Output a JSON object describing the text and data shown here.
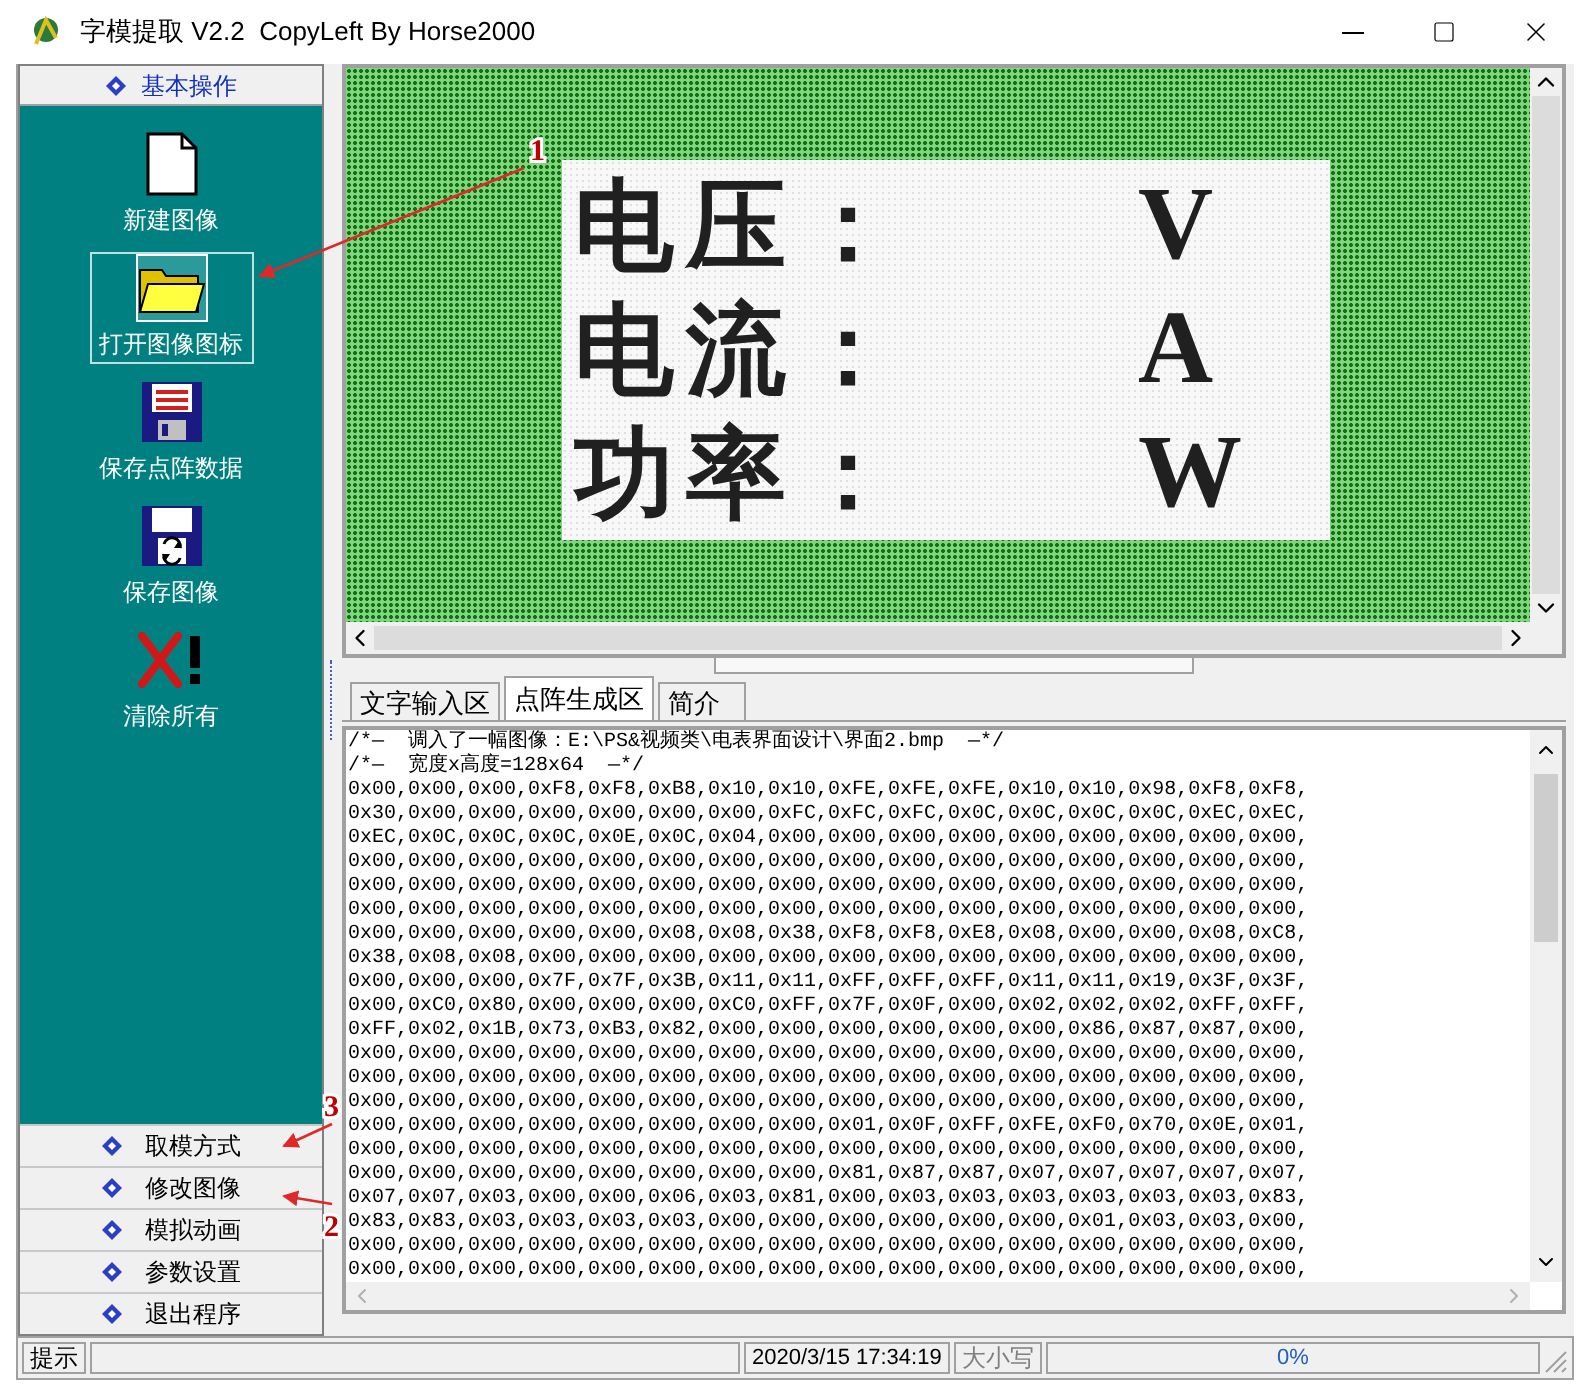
{
  "window": {
    "title": "字模提取 V2.2  CopyLeft By Horse2000"
  },
  "sidebar": {
    "header": "基本操作",
    "tools": [
      {
        "label": "新建图像",
        "kind": "new",
        "selected": false
      },
      {
        "label": "打开图像图标",
        "kind": "open",
        "selected": true
      },
      {
        "label": "保存点阵数据",
        "kind": "save-data",
        "selected": false
      },
      {
        "label": "保存图像",
        "kind": "save-image",
        "selected": false
      },
      {
        "label": "清除所有",
        "kind": "clear",
        "selected": false
      }
    ],
    "sections": [
      "取模方式",
      "修改图像",
      "模拟动画",
      "参数设置",
      "退出程序"
    ]
  },
  "canvas": {
    "rows": [
      {
        "label": "电压：",
        "unit": "V"
      },
      {
        "label": "电流：",
        "unit": "A"
      },
      {
        "label": "功率：",
        "unit": "W"
      }
    ]
  },
  "tabs": [
    {
      "label": "文字输入区",
      "selected": false
    },
    {
      "label": "点阵生成区",
      "selected": true
    },
    {
      "label": "简介",
      "selected": false
    }
  ],
  "output": {
    "lines": [
      "/*—  调入了一幅图像：E:\\PS&视频类\\电表界面设计\\界面2.bmp  —*/",
      "/*—  宽度x高度=128x64  —*/",
      "0x00,0x00,0x00,0xF8,0xF8,0xB8,0x10,0x10,0xFE,0xFE,0xFE,0x10,0x10,0x98,0xF8,0xF8,",
      "0x30,0x00,0x00,0x00,0x00,0x00,0x00,0xFC,0xFC,0xFC,0x0C,0x0C,0x0C,0x0C,0xEC,0xEC,",
      "0xEC,0x0C,0x0C,0x0C,0x0E,0x0C,0x04,0x00,0x00,0x00,0x00,0x00,0x00,0x00,0x00,0x00,",
      "0x00,0x00,0x00,0x00,0x00,0x00,0x00,0x00,0x00,0x00,0x00,0x00,0x00,0x00,0x00,0x00,",
      "0x00,0x00,0x00,0x00,0x00,0x00,0x00,0x00,0x00,0x00,0x00,0x00,0x00,0x00,0x00,0x00,",
      "0x00,0x00,0x00,0x00,0x00,0x00,0x00,0x00,0x00,0x00,0x00,0x00,0x00,0x00,0x00,0x00,",
      "0x00,0x00,0x00,0x00,0x00,0x08,0x08,0x38,0xF8,0xF8,0xE8,0x08,0x00,0x00,0x08,0xC8,",
      "0x38,0x08,0x08,0x00,0x00,0x00,0x00,0x00,0x00,0x00,0x00,0x00,0x00,0x00,0x00,0x00,",
      "0x00,0x00,0x00,0x7F,0x7F,0x3B,0x11,0x11,0xFF,0xFF,0xFF,0x11,0x11,0x19,0x3F,0x3F,",
      "0x00,0xC0,0x80,0x00,0x00,0x00,0xC0,0xFF,0x7F,0x0F,0x00,0x02,0x02,0x02,0xFF,0xFF,",
      "0xFF,0x02,0x1B,0x73,0xB3,0x82,0x00,0x00,0x00,0x00,0x00,0x00,0x86,0x87,0x87,0x00,",
      "0x00,0x00,0x00,0x00,0x00,0x00,0x00,0x00,0x00,0x00,0x00,0x00,0x00,0x00,0x00,0x00,",
      "0x00,0x00,0x00,0x00,0x00,0x00,0x00,0x00,0x00,0x00,0x00,0x00,0x00,0x00,0x00,0x00,",
      "0x00,0x00,0x00,0x00,0x00,0x00,0x00,0x00,0x00,0x00,0x00,0x00,0x00,0x00,0x00,0x00,",
      "0x00,0x00,0x00,0x00,0x00,0x00,0x00,0x00,0x01,0x0F,0xFF,0xFE,0xF0,0x70,0x0E,0x01,",
      "0x00,0x00,0x00,0x00,0x00,0x00,0x00,0x00,0x00,0x00,0x00,0x00,0x00,0x00,0x00,0x00,",
      "0x00,0x00,0x00,0x00,0x00,0x00,0x00,0x00,0x81,0x87,0x87,0x07,0x07,0x07,0x07,0x07,",
      "0x07,0x07,0x03,0x00,0x00,0x06,0x03,0x81,0x00,0x03,0x03,0x03,0x03,0x03,0x03,0x83,",
      "0x83,0x83,0x03,0x03,0x03,0x03,0x00,0x00,0x00,0x00,0x00,0x00,0x01,0x03,0x03,0x00,",
      "0x00,0x00,0x00,0x00,0x00,0x00,0x00,0x00,0x00,0x00,0x00,0x00,0x00,0x00,0x00,0x00,",
      "0x00,0x00,0x00,0x00,0x00,0x00,0x00,0x00,0x00,0x00,0x00,0x00,0x00,0x00,0x00,0x00,"
    ]
  },
  "status_bar": {
    "hint": "提示",
    "datetime": "2020/3/15 17:34:19",
    "caps": "大小写",
    "progress": "0%",
    "level": 0
  },
  "annotations": [
    "1",
    "2",
    "3"
  ]
}
